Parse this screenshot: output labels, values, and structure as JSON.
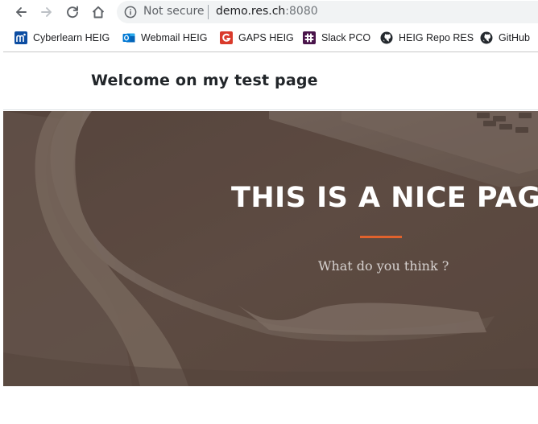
{
  "browser": {
    "address_bar": {
      "security_text": "Not secure",
      "host": "demo.res.ch",
      "port": ":8080"
    },
    "nav_icons": [
      "back-arrow-icon",
      "forward-arrow-icon",
      "reload-icon",
      "home-icon"
    ],
    "bookmarks": [
      {
        "label": "Cyberlearn HEIG",
        "icon": "moodle-icon",
        "color": "#0c4da2"
      },
      {
        "label": "Webmail HEIG",
        "icon": "outlook-icon",
        "color": "#0364b8"
      },
      {
        "label": "GAPS HEIG",
        "icon": "gaps-icon",
        "color": "#d93a2b"
      },
      {
        "label": "Slack PCO",
        "icon": "slack-icon",
        "color": "#4a154b"
      },
      {
        "label": "HEIG Repo RES",
        "icon": "github-icon",
        "color": "#24292e"
      },
      {
        "label": "GitHub",
        "icon": "github-icon",
        "color": "#24292e"
      }
    ]
  },
  "page": {
    "heading": "Welcome on my test page",
    "hero": {
      "title": "THIS IS A NICE PAGE",
      "subtitle": "What do you think ?",
      "accent_color": "#e0622d",
      "background_color": "#5f4c43"
    }
  }
}
